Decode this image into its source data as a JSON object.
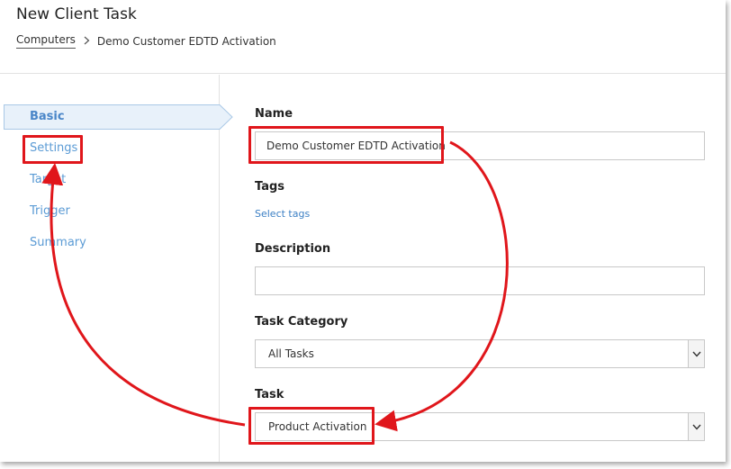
{
  "header": {
    "title": "New Client Task",
    "breadcrumb": [
      "Computers",
      "Demo Customer EDTD Activation"
    ]
  },
  "sidebar": {
    "items": [
      {
        "label": "Basic",
        "active": true
      },
      {
        "label": "Settings"
      },
      {
        "label": "Target"
      },
      {
        "label": "Trigger"
      },
      {
        "label": "Summary"
      }
    ]
  },
  "form": {
    "name_label": "Name",
    "name_value": "Demo Customer EDTD Activation",
    "tags_label": "Tags",
    "select_tags": "Select tags",
    "description_label": "Description",
    "description_value": "",
    "task_category_label": "Task Category",
    "task_category_value": "All Tasks",
    "task_label": "Task",
    "task_value": "Product Activation"
  },
  "colors": {
    "accent": "#4a86c8",
    "highlight": "#e0161b"
  }
}
